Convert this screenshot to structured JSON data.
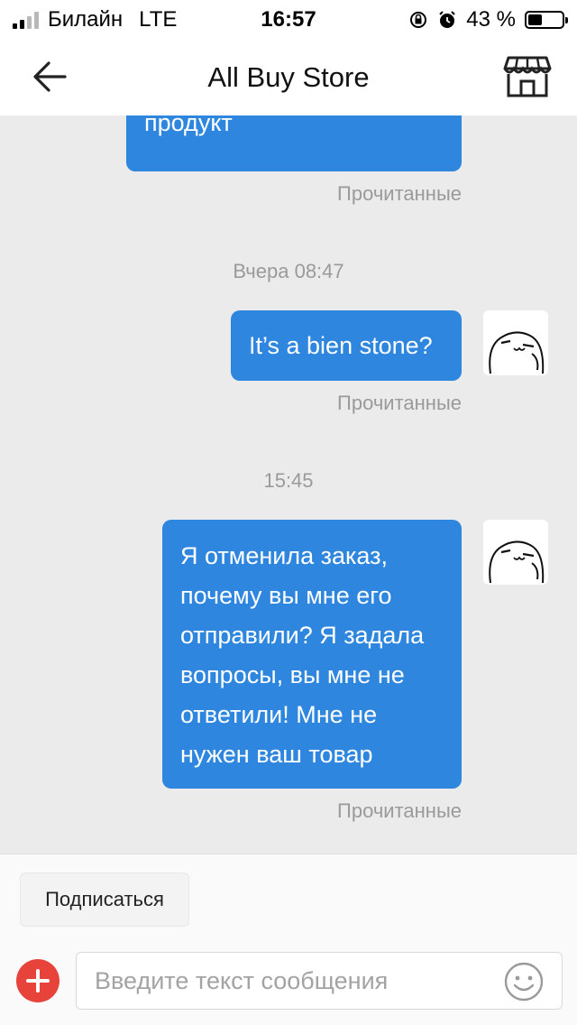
{
  "status_bar": {
    "carrier": "Билайн",
    "network": "LTE",
    "time": "16:57",
    "battery": "43 %",
    "battery_level": 0.43,
    "icons": [
      "signal-icon",
      "rotation-lock-icon",
      "alarm-icon",
      "battery-icon"
    ]
  },
  "nav": {
    "title": "All Buy Store",
    "back_icon": "back-arrow-icon",
    "store_icon": "store-icon"
  },
  "messages": {
    "msg_top": {
      "text": "продукт",
      "status": "Прочитанные"
    },
    "time_1": "Вчера 08:47",
    "msg_2": {
      "text": "It’s a bien stone?",
      "status": "Прочитанные"
    },
    "time_2": "15:45",
    "msg_3": {
      "lines": [
        "Я отменила заказ,",
        "почему вы мне его",
        "отправили? Я задала",
        "вопросы, вы мне не",
        "ответили! Мне не",
        "нужен ваш товар"
      ],
      "status": "Прочитанные"
    }
  },
  "bottom": {
    "subscribe_label": "Подписаться",
    "input_placeholder": "Введите текст сообщения",
    "input_value": "",
    "plus_icon": "plus-circle-icon",
    "emoji_icon": "smiley-icon"
  },
  "colors": {
    "bubble": "#2e86de",
    "chat_bg": "#ebebeb",
    "plus": "#e8433a",
    "meta_text": "#9a9a9a"
  }
}
